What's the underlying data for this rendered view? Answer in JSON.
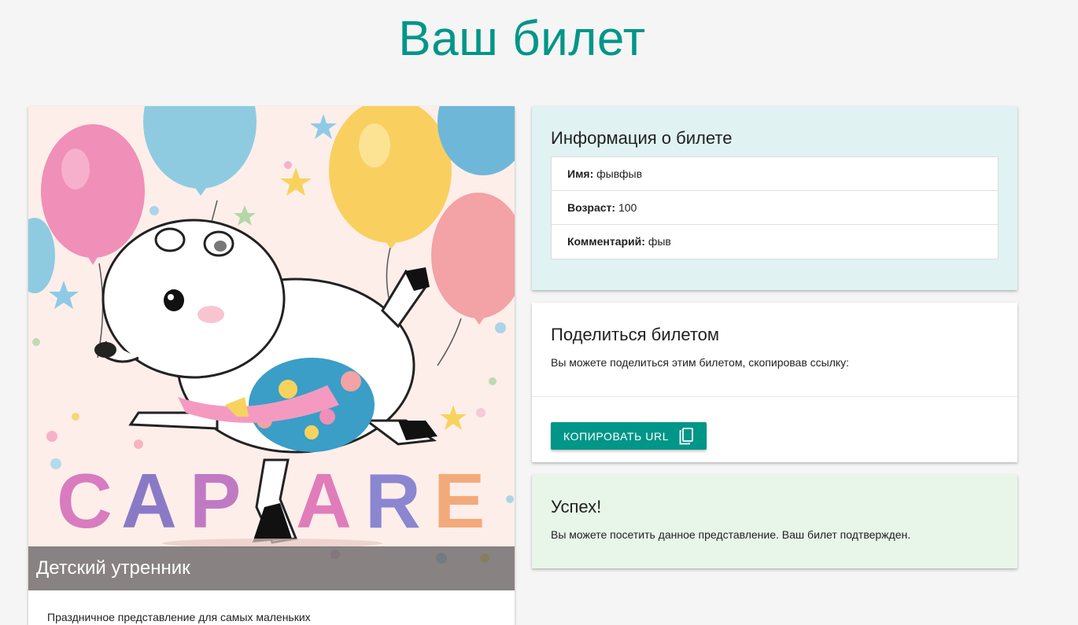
{
  "page": {
    "title": "Ваш билет"
  },
  "event": {
    "title": "Детский утренник",
    "description": "Праздничное представление для самых маленьких",
    "image_text": "CAPARE"
  },
  "info": {
    "title": "Информация о билете",
    "rows": [
      {
        "label": "Имя:",
        "value": "фывфыв"
      },
      {
        "label": "Возраст:",
        "value": "100"
      },
      {
        "label": "Комментарий:",
        "value": "фыв"
      }
    ]
  },
  "share": {
    "title": "Поделиться билетом",
    "text": "Вы можете поделиться этим билетом, скопировав ссылку:",
    "button_label": "КОПИРОВАТЬ URL",
    "button_icon": "copy-icon"
  },
  "success": {
    "title": "Успех!",
    "text": "Вы можете посетить данное представление. Ваш билет подтвержден."
  },
  "colors": {
    "accent": "#009688",
    "info_bg": "#e0f2f1",
    "success_bg": "#e8f5e9",
    "page_bg": "#f5f5f5"
  }
}
